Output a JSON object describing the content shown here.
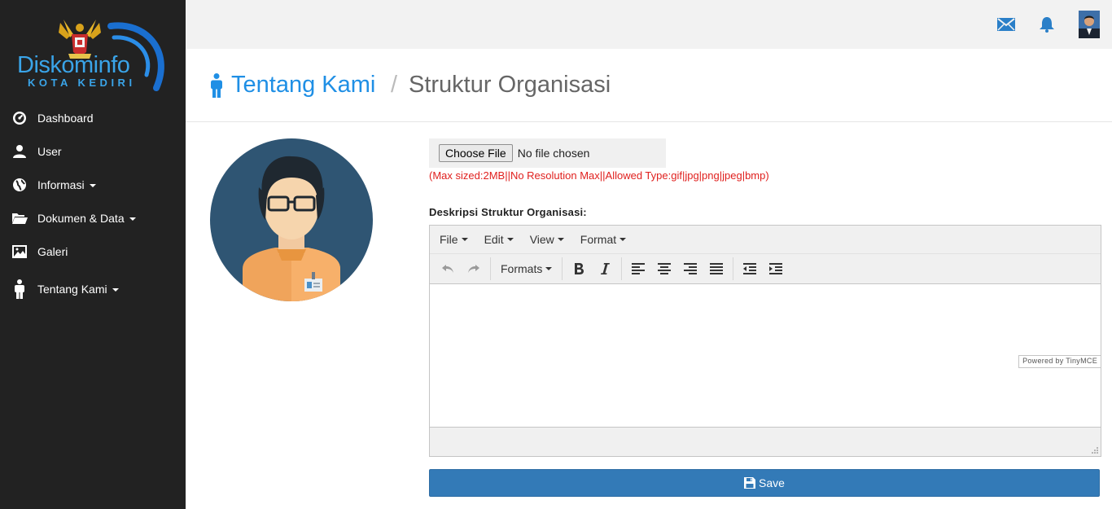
{
  "brand": {
    "name": "Diskominfo",
    "subtitle": "KOTA KEDIRI"
  },
  "sidebar": {
    "items": [
      {
        "label": "Dashboard",
        "icon": "dashboard-icon",
        "has_caret": false
      },
      {
        "label": "User",
        "icon": "user-icon",
        "has_caret": false
      },
      {
        "label": "Informasi",
        "icon": "globe-icon",
        "has_caret": true
      },
      {
        "label": "Dokumen & Data",
        "icon": "folder-open-icon",
        "has_caret": true
      },
      {
        "label": "Galeri",
        "icon": "picture-icon",
        "has_caret": false
      },
      {
        "label": "Tentang Kami",
        "icon": "person-icon",
        "has_caret": true
      }
    ]
  },
  "topbar": {
    "icons": [
      "envelope-icon",
      "bell-icon",
      "profile-avatar"
    ]
  },
  "header": {
    "section": "Tentang Kami",
    "separator": "/",
    "page": "Struktur Organisasi"
  },
  "upload": {
    "button_label": "Choose File",
    "status": "No file chosen",
    "help": "(Max sized:2MB||No Resolution Max||Allowed Type:gif|jpg|png|jpeg|bmp)"
  },
  "form": {
    "description_label": "Deskripsi Struktur Organisasi:",
    "save_label": "Save"
  },
  "editor": {
    "menus": [
      "File",
      "Edit",
      "View",
      "Format"
    ],
    "formats_label": "Formats",
    "powered_by": "Powered by TinyMCE",
    "content": ""
  },
  "colors": {
    "sidebar_bg": "#222222",
    "accent": "#1f8fe5",
    "primary_button": "#337ab7",
    "help_text": "#e0201e"
  }
}
